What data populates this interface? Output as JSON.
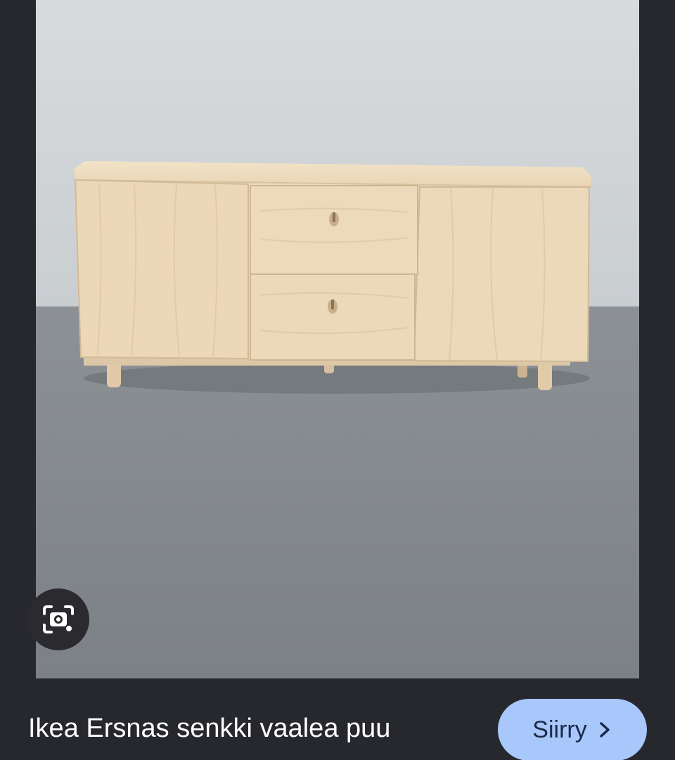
{
  "result": {
    "caption": "Ikea Ersnas senkki vaalea puu",
    "go_button_label": "Siirry"
  },
  "icons": {
    "lens": "google-lens-icon",
    "go_arrow": "chevron-right-icon"
  },
  "colors": {
    "background": "#27282d",
    "button_fill": "#a8c7fa",
    "button_text": "#1b2a4a",
    "caption_text": "#ffffff"
  }
}
